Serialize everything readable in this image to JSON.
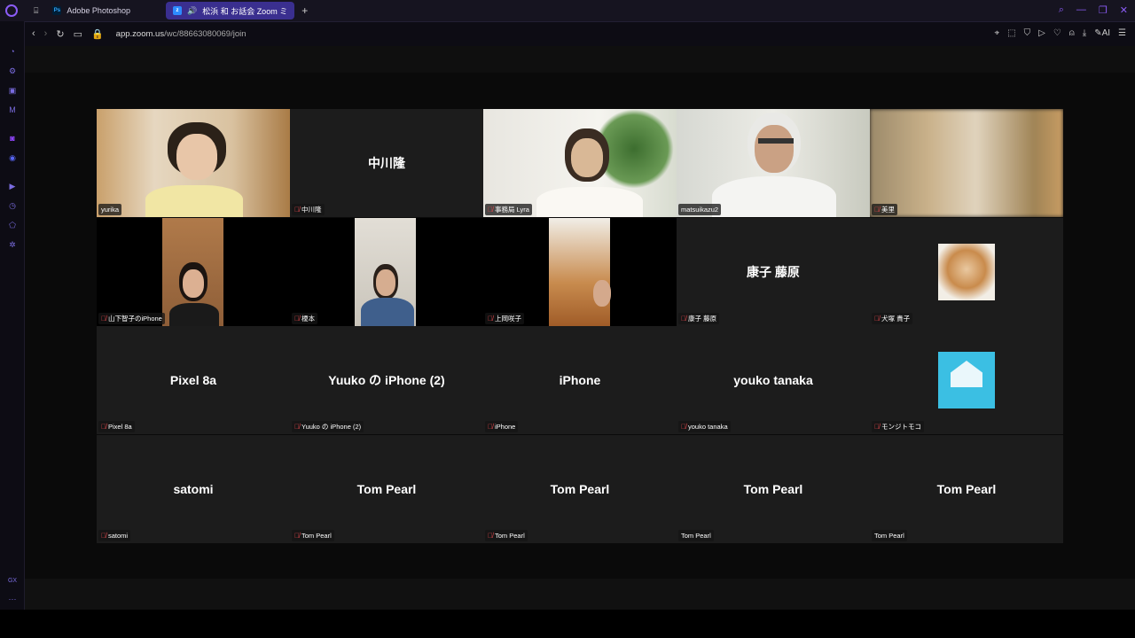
{
  "tabs": [
    {
      "label": "Adobe Photoshop",
      "icon": "photoshop-icon",
      "active": false
    },
    {
      "label": "松浜 和 お話会 Zoom ミ",
      "icon": "zoom-icon",
      "active": true
    }
  ],
  "address": {
    "host": "app.zoom.us",
    "path": "/wc/88663080069/join"
  },
  "brand": {
    "accent": "#8b5cf6",
    "active_tab": "#3a2f8f",
    "speaker_border": "#3fb54a",
    "mute_red": "#e5484d"
  },
  "participants": [
    {
      "label": "yurika",
      "center": "",
      "muted": false,
      "video": "yurika"
    },
    {
      "label": "中川隆",
      "center": "中川隆",
      "muted": true,
      "video": ""
    },
    {
      "label": "事務局 Lyra",
      "center": "",
      "muted": true,
      "video": "lyra"
    },
    {
      "label": "matsuikazu2",
      "center": "",
      "muted": false,
      "video": "matsui",
      "speaking": true
    },
    {
      "label": "美里",
      "center": "",
      "muted": true,
      "video": "blur"
    },
    {
      "label": "山下智子のiPhone",
      "center": "",
      "muted": true,
      "video": "yamashita"
    },
    {
      "label": "榎本",
      "center": "",
      "muted": true,
      "video": "enomoto"
    },
    {
      "label": "上岡咲子",
      "center": "",
      "muted": true,
      "video": "kamioka"
    },
    {
      "label": "康子 藤原",
      "center": "康子 藤原",
      "muted": true,
      "video": ""
    },
    {
      "label": "犬塚 貴子",
      "center": "",
      "muted": true,
      "video": "cat"
    },
    {
      "label": "Pixel 8a",
      "center": "Pixel 8a",
      "muted": true,
      "video": ""
    },
    {
      "label": "Yuuko の iPhone (2)",
      "center": "Yuuko の iPhone (2)",
      "muted": true,
      "video": ""
    },
    {
      "label": "iPhone",
      "center": "iPhone",
      "muted": true,
      "video": ""
    },
    {
      "label": "youko tanaka",
      "center": "youko tanaka",
      "muted": true,
      "video": ""
    },
    {
      "label": "モンジトモコ",
      "center": "",
      "muted": true,
      "video": "house"
    },
    {
      "label": "satomi",
      "center": "satomi",
      "muted": true,
      "video": ""
    },
    {
      "label": "Tom Pearl",
      "center": "Tom Pearl",
      "muted": true,
      "video": ""
    },
    {
      "label": "Tom Pearl",
      "center": "Tom Pearl",
      "muted": true,
      "video": ""
    },
    {
      "label": "Tom Pearl",
      "center": "Tom Pearl",
      "muted": false,
      "video": ""
    },
    {
      "label": "Tom Pearl",
      "center": "Tom Pearl",
      "muted": false,
      "video": ""
    }
  ],
  "sidebar_bottom": "GX"
}
